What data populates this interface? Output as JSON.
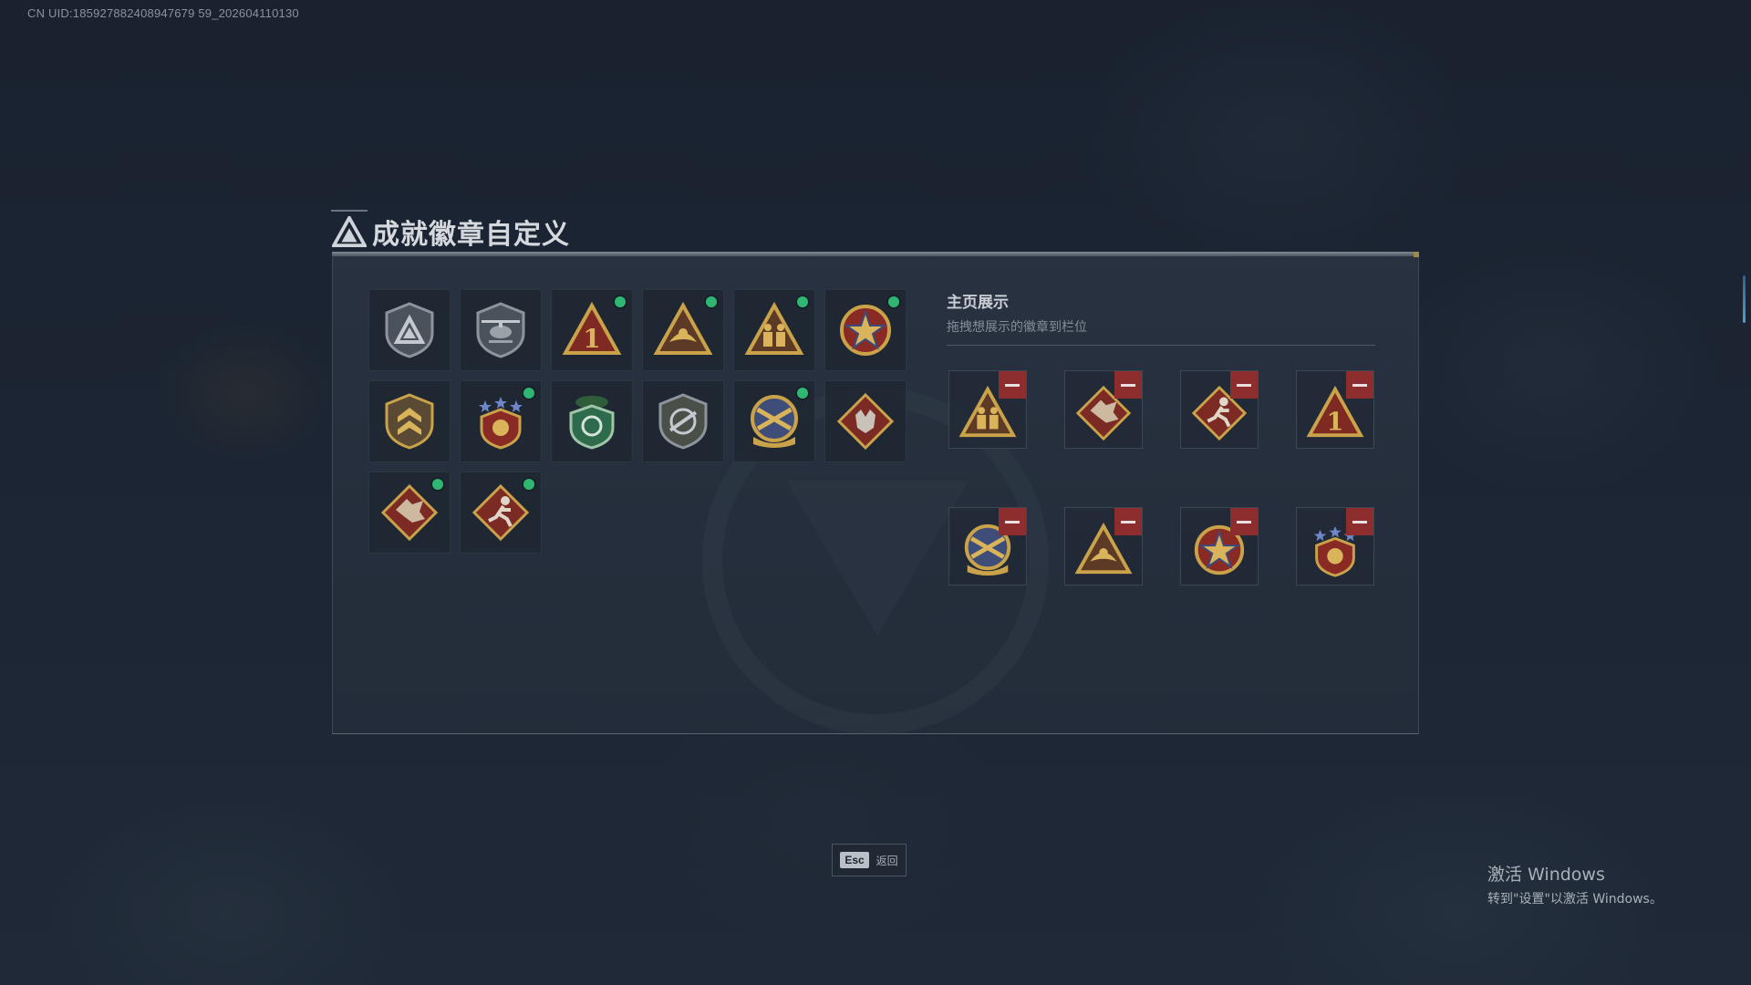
{
  "uid_text": "CN UID:185927882408947679 59_202604110130",
  "window": {
    "title": "成就徽章自定义"
  },
  "collection": {
    "badges": [
      {
        "icon": "grey-shield-triangle-badge-icon",
        "new": false
      },
      {
        "icon": "grey-helicopter-badge-icon",
        "new": false
      },
      {
        "icon": "gold-number-one-triangle-badge-icon",
        "new": true
      },
      {
        "icon": "gold-eagle-triangle-badge-icon",
        "new": true
      },
      {
        "icon": "gold-soldiers-triangle-badge-icon",
        "new": true
      },
      {
        "icon": "red-star-round-badge-icon",
        "new": true
      },
      {
        "icon": "gold-chevron-shield-badge-icon",
        "new": false
      },
      {
        "icon": "red-crest-starred-badge-icon",
        "new": true
      },
      {
        "icon": "green-beret-shield-badge-icon",
        "new": false
      },
      {
        "icon": "grey-rifle-shield-badge-icon",
        "new": false
      },
      {
        "icon": "gold-crossed-guns-round-badge-icon",
        "new": true
      },
      {
        "icon": "red-wolf-diamond-badge-icon",
        "new": false
      },
      {
        "icon": "red-dragon-diamond-badge-icon",
        "new": true
      },
      {
        "icon": "red-runner-diamond-badge-icon",
        "new": true
      }
    ]
  },
  "showcase": {
    "title": "主页展示",
    "subtitle": "拖拽想展示的徽章到栏位",
    "slots": [
      {
        "icon": "gold-soldiers-triangle-badge-icon"
      },
      {
        "icon": "red-dragon-diamond-badge-icon"
      },
      {
        "icon": "red-runner-diamond-badge-icon"
      },
      {
        "icon": "gold-number-one-triangle-badge-icon"
      },
      {
        "icon": "gold-crossed-guns-round-badge-icon"
      },
      {
        "icon": "gold-eagle-triangle-badge-icon"
      },
      {
        "icon": "red-star-round-badge-icon"
      },
      {
        "icon": "red-crest-starred-badge-icon"
      }
    ]
  },
  "footer": {
    "esc_key": "Esc",
    "esc_label": "返回"
  },
  "watermark": {
    "line1": "激活 Windows",
    "line2": "转到\"设置\"以激活 Windows。"
  },
  "colors": {
    "new_dot": "#2fb673",
    "remove": "#8e2d2d",
    "gold": "#c9a24a",
    "red": "#8a2a24"
  }
}
